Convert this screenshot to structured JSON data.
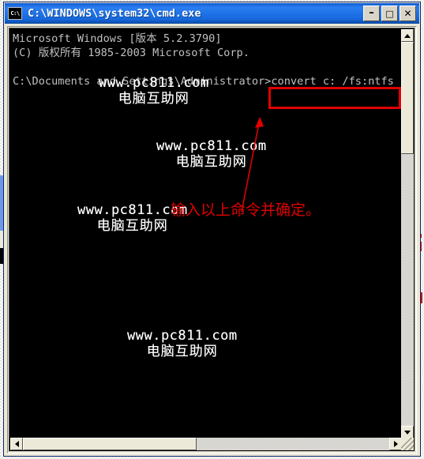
{
  "window": {
    "title": "C:\\WINDOWS\\system32\\cmd.exe",
    "icon_name": "cmd-console-icon",
    "icon_label": "C:\\",
    "buttons": {
      "minimize": "–",
      "maximize": "□",
      "close": "✕"
    },
    "accent_color": "#1f72e8",
    "face_color": "#ece9d8"
  },
  "console": {
    "background_color": "#000000",
    "text_color": "#c0c0c0",
    "lines": [
      "Microsoft Windows [版本 5.2.3790]",
      "(C) 版权所有 1985-2003 Microsoft Corp.",
      "",
      "C:\\Documents and Settings\\Administrator>convert c: /fs:ntfs"
    ],
    "command": "convert c: /fs:ntfs",
    "prompt": "C:\\Documents and Settings\\Administrator>"
  },
  "annotations": {
    "color": "#e00000",
    "highlight_box_label": "convert c: /fs:ntfs",
    "note": "输入以上命令并确定。",
    "arrow_name": "red-arrow-pointer"
  },
  "watermarks": [
    {
      "url": "www.pc811.com",
      "cn": "电脑互助网"
    },
    {
      "url": "www.pc811.com",
      "cn": "电脑互助网"
    },
    {
      "url": "www.pc811.com",
      "cn": "电脑互助网"
    },
    {
      "url": "www.pc811.com",
      "cn": "电脑互助网"
    }
  ],
  "scrollbars": {
    "vertical": {
      "up_arrow": "▲",
      "down_arrow": "▼"
    },
    "horizontal": {
      "left_arrow": "◀",
      "right_arrow": "▶"
    }
  }
}
